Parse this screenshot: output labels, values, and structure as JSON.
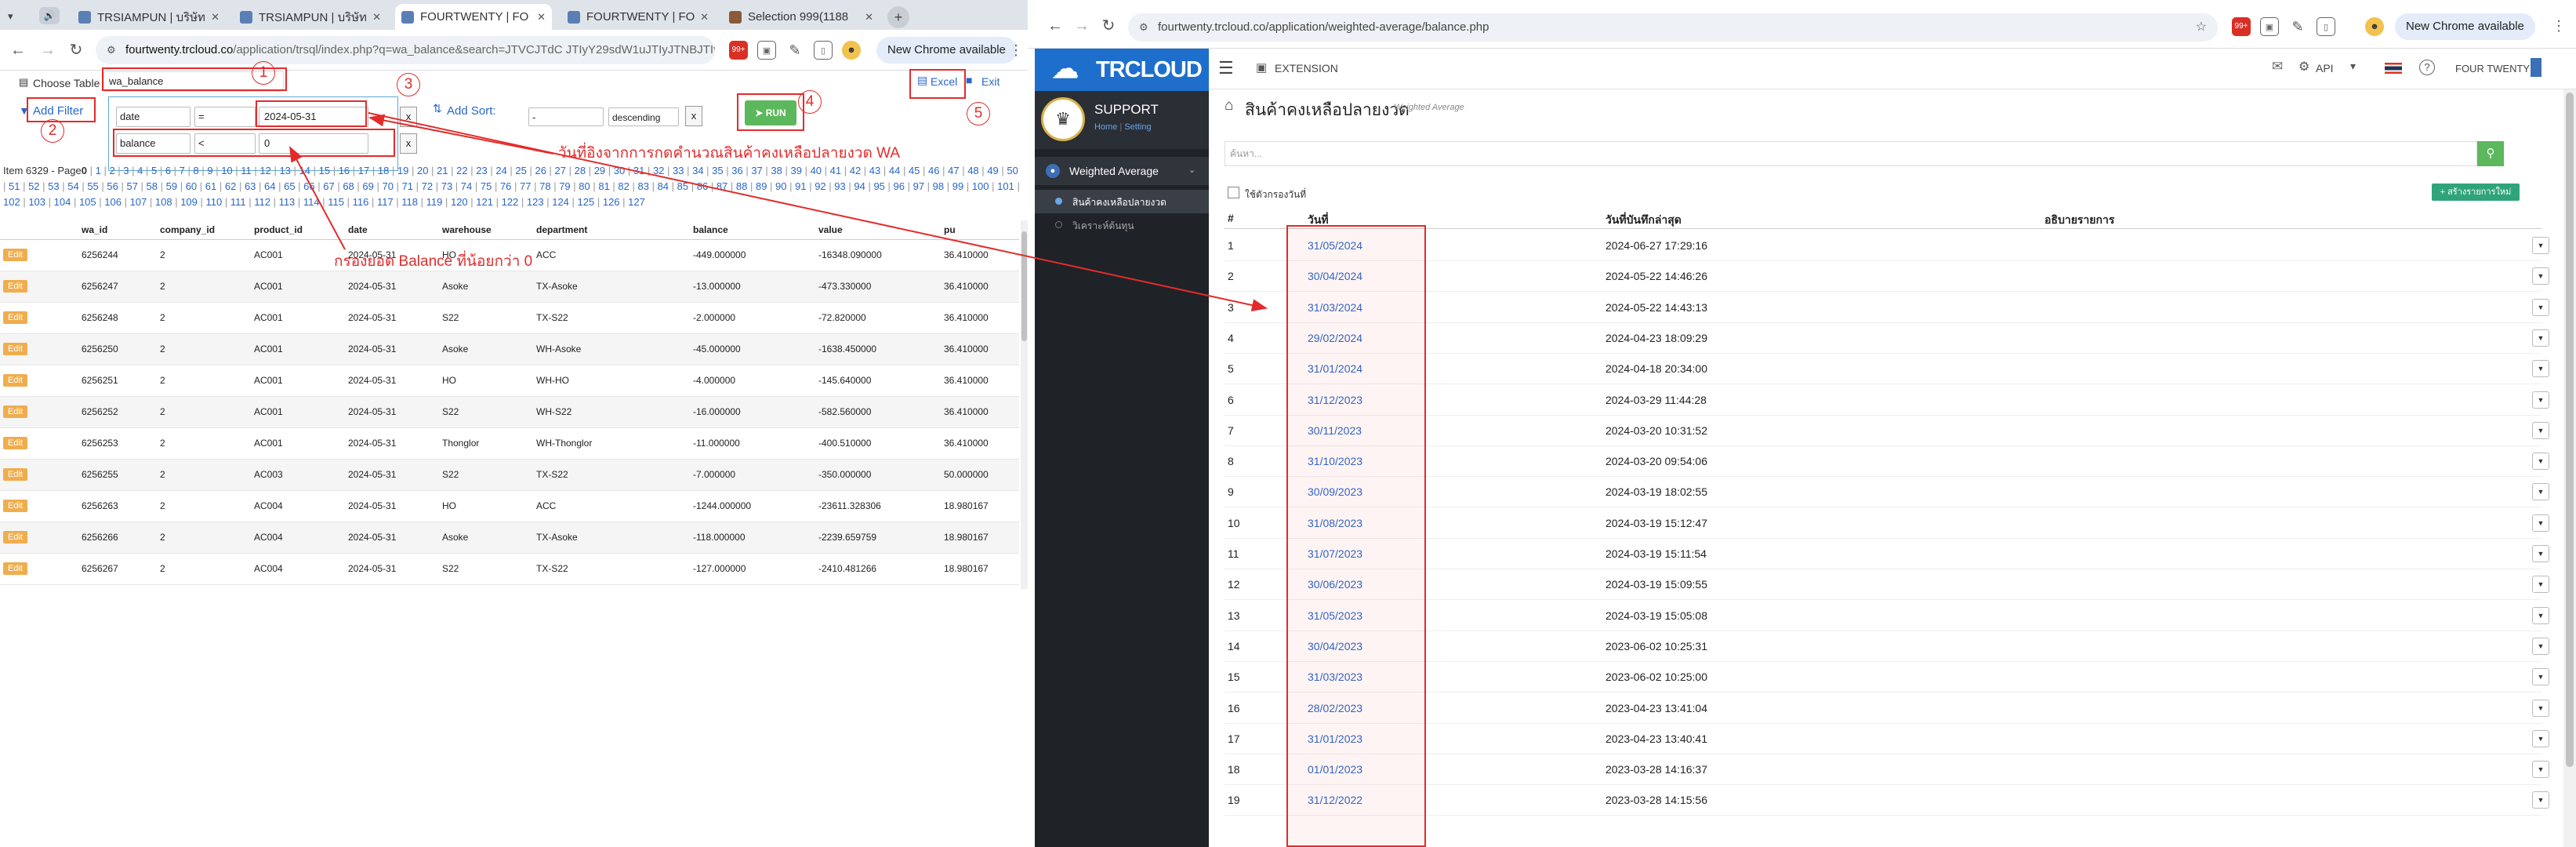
{
  "left_browser": {
    "tabs": [
      {
        "label": "TRSIAMPUN | บริษัท"
      },
      {
        "label": "TRSIAMPUN | บริษัท"
      },
      {
        "label": "FOURTWENTY | FO"
      },
      {
        "label": "FOURTWENTY | FO"
      },
      {
        "label": "Selection 999(1188"
      }
    ],
    "url_domain": "fourtwenty.trcloud.co",
    "url_path": "/application/trsql/index.php?q=wa_balance&search=JTVCJTdC JTIyY29sdW1uJTIyJTNBJTIyZ...",
    "extension_badge": "99+",
    "new_chrome": "New Chrome available",
    "choose_table_label": "Choose Table",
    "table_value": "wa_balance",
    "excel_label": "Excel",
    "exit_label": "Exit",
    "add_filter_label": "Add Filter",
    "add_sort_label": "Add Sort:",
    "filters": [
      {
        "column": "date",
        "op": "=",
        "value": "2024-05-31"
      },
      {
        "column": "balance",
        "op": "<",
        "value": "0"
      }
    ],
    "sort_column": "-",
    "sort_dir": "descending",
    "x_label": "x",
    "run_label": "RUN",
    "pager_prefix": "Item 6329 - Page",
    "pager_current": "0",
    "page_numbers_count": 127,
    "columns": [
      "",
      "wa_id",
      "company_id",
      "product_id",
      "date",
      "warehouse",
      "department",
      "balance",
      "value",
      "pu"
    ],
    "edit_label": "Edit",
    "rows": [
      [
        "6256244",
        "2",
        "AC001",
        "2024-05-31",
        "HO",
        "ACC",
        "-449.000000",
        "-16348.090000",
        "36.410000"
      ],
      [
        "6256247",
        "2",
        "AC001",
        "2024-05-31",
        "Asoke",
        "TX-Asoke",
        "-13.000000",
        "-473.330000",
        "36.410000"
      ],
      [
        "6256248",
        "2",
        "AC001",
        "2024-05-31",
        "S22",
        "TX-S22",
        "-2.000000",
        "-72.820000",
        "36.410000"
      ],
      [
        "6256250",
        "2",
        "AC001",
        "2024-05-31",
        "Asoke",
        "WH-Asoke",
        "-45.000000",
        "-1638.450000",
        "36.410000"
      ],
      [
        "6256251",
        "2",
        "AC001",
        "2024-05-31",
        "HO",
        "WH-HO",
        "-4.000000",
        "-145.640000",
        "36.410000"
      ],
      [
        "6256252",
        "2",
        "AC001",
        "2024-05-31",
        "S22",
        "WH-S22",
        "-16.000000",
        "-582.560000",
        "36.410000"
      ],
      [
        "6256253",
        "2",
        "AC001",
        "2024-05-31",
        "Thonglor",
        "WH-Thonglor",
        "-11.000000",
        "-400.510000",
        "36.410000"
      ],
      [
        "6256255",
        "2",
        "AC003",
        "2024-05-31",
        "S22",
        "TX-S22",
        "-7.000000",
        "-350.000000",
        "50.000000"
      ],
      [
        "6256263",
        "2",
        "AC004",
        "2024-05-31",
        "HO",
        "ACC",
        "-1244.000000",
        "-23611.328306",
        "18.980167"
      ],
      [
        "6256266",
        "2",
        "AC004",
        "2024-05-31",
        "Asoke",
        "TX-Asoke",
        "-118.000000",
        "-2239.659759",
        "18.980167"
      ],
      [
        "6256267",
        "2",
        "AC004",
        "2024-05-31",
        "S22",
        "TX-S22",
        "-127.000000",
        "-2410.481266",
        "18.980167"
      ]
    ]
  },
  "annotations": {
    "numbers": [
      "1",
      "2",
      "3",
      "4",
      "5"
    ],
    "note_date": "วันที่อิงจากการกดคำนวณสินค้าคงเหลือปลายงวด WA",
    "note_balance": "กรองยอด Balance ที่น้อยกว่า 0",
    "color": "#e32b2b"
  },
  "right_browser": {
    "url": "fourtwenty.trcloud.co/application/weighted-average/balance.php",
    "extension_badge": "99+",
    "new_chrome": "New Chrome available",
    "brand": "TRCLOUD",
    "support_title": "SUPPORT",
    "support_home": "Home",
    "support_setting": "Setting",
    "menu_section": "Weighted Average",
    "menu_items": [
      "สินค้าคงเหลือปลายงวด",
      "วิเคราะห์ต้นทุน"
    ],
    "topbar_extension": "EXTENSION",
    "topbar_api": "API",
    "topbar_company": "FOUR TWENTY",
    "page_title": "สินค้าคงเหลือปลายงวด",
    "page_subtitle": "Weighted Average",
    "search_placeholder": "ค้นหา...",
    "checkbox_label": "ใช้ตัวกรองวันที่",
    "add_button": "สร้างรายการใหม่",
    "headers": [
      "#",
      "วันที่",
      "วันที่บันทึกล่าสุด",
      "อธิบายรายการ"
    ],
    "rows": [
      [
        "1",
        "31/05/2024",
        "2024-06-27 17:29:16"
      ],
      [
        "2",
        "30/04/2024",
        "2024-05-22 14:46:26"
      ],
      [
        "3",
        "31/03/2024",
        "2024-05-22 14:43:13"
      ],
      [
        "4",
        "29/02/2024",
        "2024-04-23 18:09:29"
      ],
      [
        "5",
        "31/01/2024",
        "2024-04-18 20:34:00"
      ],
      [
        "6",
        "31/12/2023",
        "2024-03-29 11:44:28"
      ],
      [
        "7",
        "30/11/2023",
        "2024-03-20 10:31:52"
      ],
      [
        "8",
        "31/10/2023",
        "2024-03-20 09:54:06"
      ],
      [
        "9",
        "30/09/2023",
        "2024-03-19 18:02:55"
      ],
      [
        "10",
        "31/08/2023",
        "2024-03-19 15:12:47"
      ],
      [
        "11",
        "31/07/2023",
        "2024-03-19 15:11:54"
      ],
      [
        "12",
        "30/06/2023",
        "2024-03-19 15:09:55"
      ],
      [
        "13",
        "31/05/2023",
        "2024-03-19 15:05:08"
      ],
      [
        "14",
        "30/04/2023",
        "2023-06-02 10:25:31"
      ],
      [
        "15",
        "31/03/2023",
        "2023-06-02 10:25:00"
      ],
      [
        "16",
        "28/02/2023",
        "2023-04-23 13:41:04"
      ],
      [
        "17",
        "31/01/2023",
        "2023-04-23 13:40:41"
      ],
      [
        "18",
        "01/01/2023",
        "2023-03-28 14:16:37"
      ],
      [
        "19",
        "31/12/2022",
        "2023-03-28 14:15:56"
      ]
    ]
  }
}
